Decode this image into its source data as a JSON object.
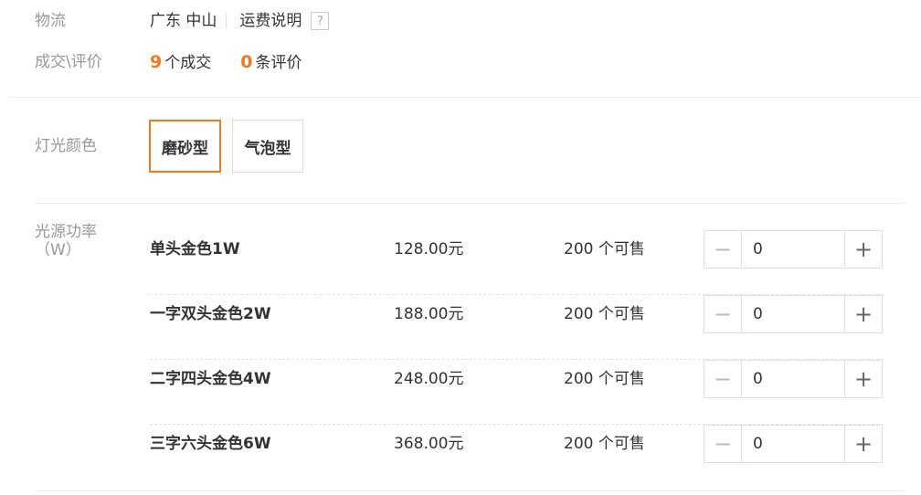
{
  "shipping": {
    "label": "物流",
    "origin": "广东 中山",
    "link": "运费说明",
    "help_icon": "?"
  },
  "deals": {
    "label": "成交\\评价",
    "deal_count": "9",
    "deal_unit": "个成交",
    "review_count": "0",
    "review_unit": "条评价"
  },
  "light_color": {
    "label": "灯光颜色",
    "options": [
      {
        "label": "磨砂型",
        "selected": true
      },
      {
        "label": "气泡型",
        "selected": false
      }
    ]
  },
  "power": {
    "label_line1": "光源功率",
    "label_line2": "（W）",
    "skus": [
      {
        "name": "单头金色1W",
        "price": "128.00元",
        "stock": "200 个可售",
        "qty": "0"
      },
      {
        "name": "一字双头金色2W",
        "price": "188.00元",
        "stock": "200 个可售",
        "qty": "0"
      },
      {
        "name": "二字四头金色4W",
        "price": "248.00元",
        "stock": "200 个可售",
        "qty": "0"
      },
      {
        "name": "三字六头金色6W",
        "price": "368.00元",
        "stock": "200 个可售",
        "qty": "0"
      }
    ],
    "minus_symbol": "−",
    "plus_symbol": "+"
  },
  "colors": {
    "accent": "#f07a1e",
    "label_gray": "#999999"
  }
}
